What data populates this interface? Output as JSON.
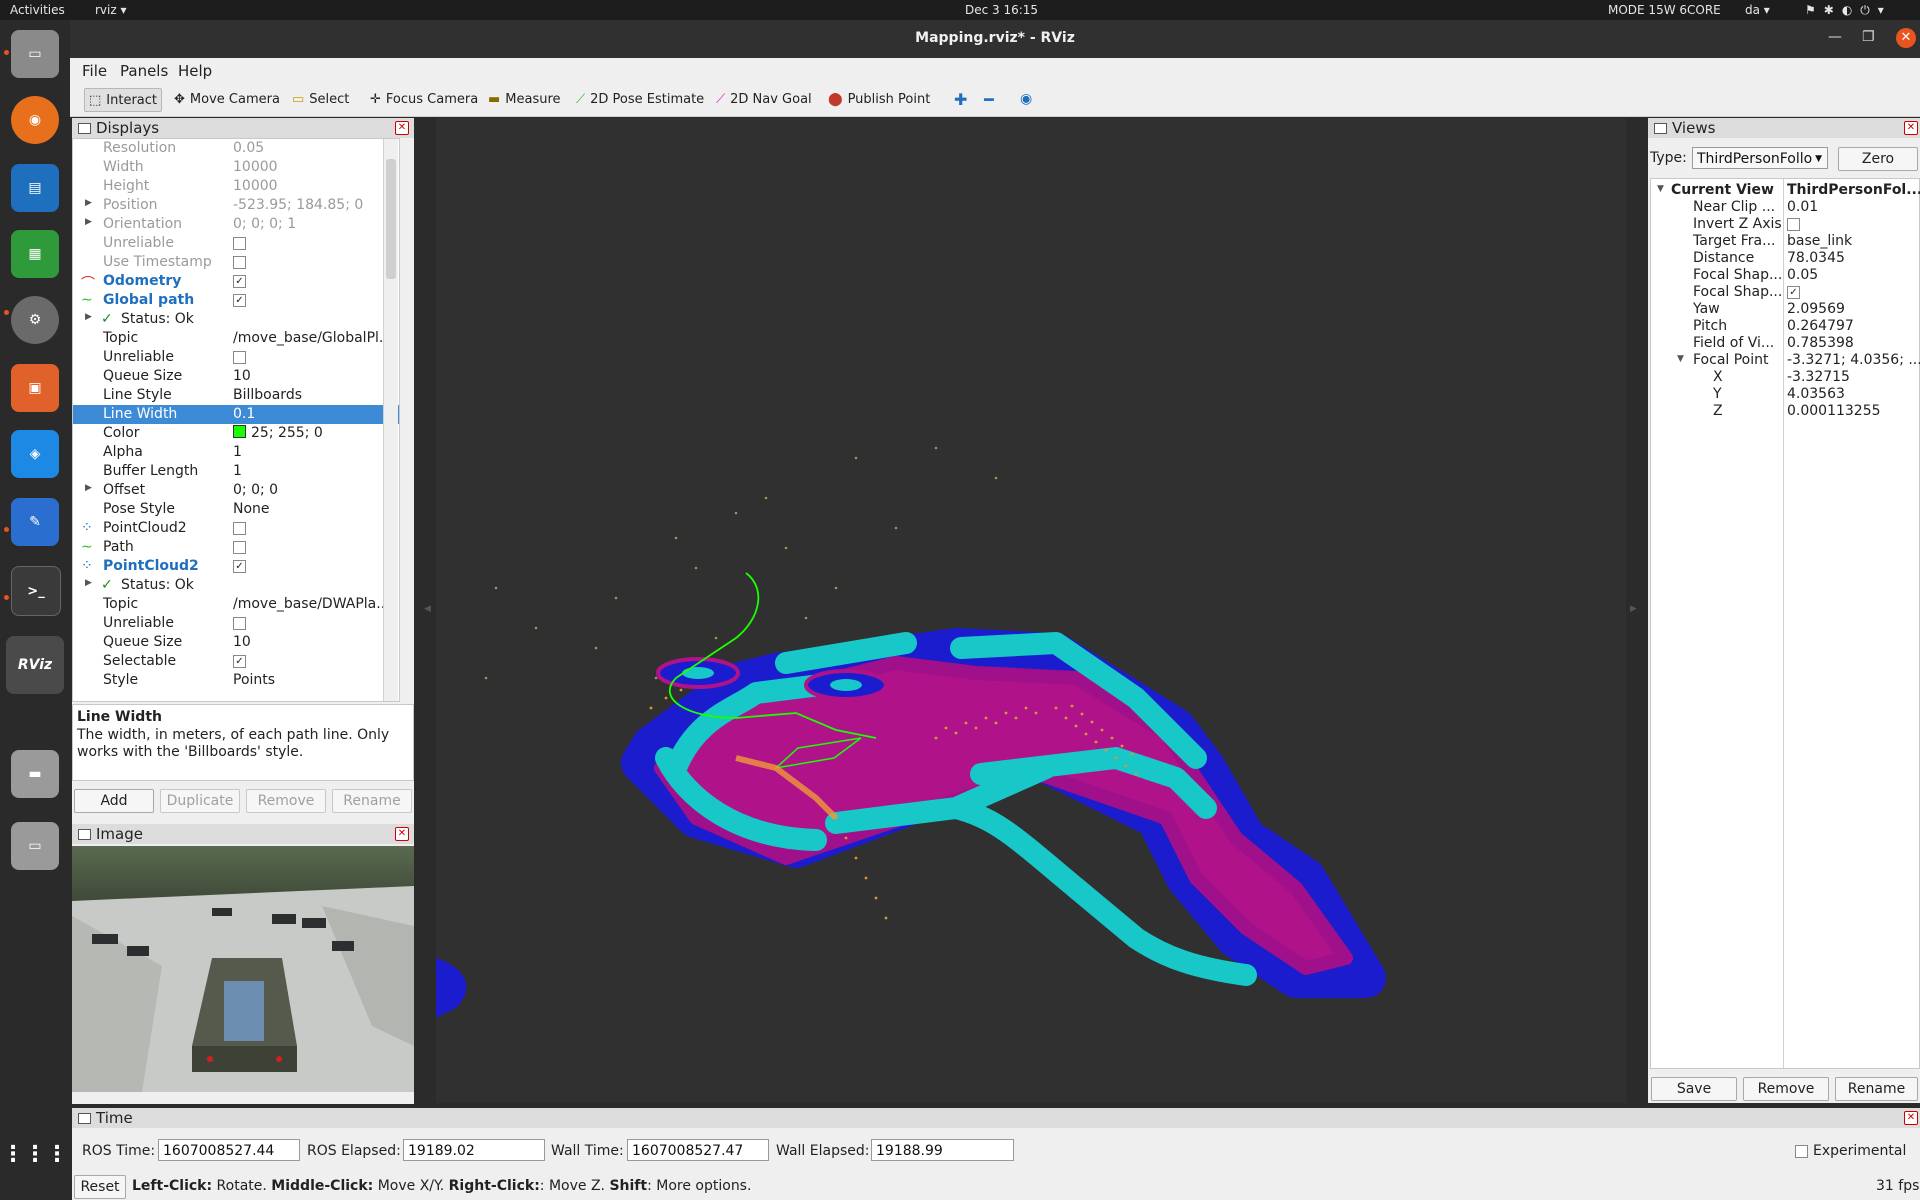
{
  "system_bar": {
    "activities": "Activities",
    "app": "rviz",
    "clock": "Dec 3  16:15",
    "mode": "MODE 15W 6CORE",
    "user": "da"
  },
  "window": {
    "title": "Mapping.rviz* - RViz"
  },
  "menu": {
    "file": "File",
    "panels": "Panels",
    "help": "Help"
  },
  "toolbar": {
    "interact": "Interact",
    "move_camera": "Move Camera",
    "select": "Select",
    "focus_camera": "Focus Camera",
    "measure": "Measure",
    "pose_estimate": "2D Pose Estimate",
    "nav_goal": "2D Nav Goal",
    "publish_point": "Publish Point"
  },
  "displays": {
    "title": "Displays",
    "rows": [
      {
        "key": "Resolution",
        "value": "0.05"
      },
      {
        "key": "Width",
        "value": "10000"
      },
      {
        "key": "Height",
        "value": "10000"
      },
      {
        "key": "Position",
        "value": "-523.95; 184.85; 0"
      },
      {
        "key": "Orientation",
        "value": "0; 0; 0; 1"
      },
      {
        "key": "Unreliable",
        "value": ""
      },
      {
        "key": "Use Timestamp",
        "value": ""
      },
      {
        "key": "Odometry",
        "value": ""
      },
      {
        "key": "Global path",
        "value": ""
      },
      {
        "key": "Status: Ok",
        "value": ""
      },
      {
        "key": "Topic",
        "value": "/move_base/GlobalPl..."
      },
      {
        "key": "Unreliable",
        "value": ""
      },
      {
        "key": "Queue Size",
        "value": "10"
      },
      {
        "key": "Line Style",
        "value": "Billboards"
      },
      {
        "key": "Line Width",
        "value": "0.1"
      },
      {
        "key": "Color",
        "value": "25; 255; 0"
      },
      {
        "key": "Alpha",
        "value": "1"
      },
      {
        "key": "Buffer Length",
        "value": "1"
      },
      {
        "key": "Offset",
        "value": "0; 0; 0"
      },
      {
        "key": "Pose Style",
        "value": "None"
      },
      {
        "key": "PointCloud2",
        "value": ""
      },
      {
        "key": "Path",
        "value": ""
      },
      {
        "key": "PointCloud2",
        "value": ""
      },
      {
        "key": "Status: Ok",
        "value": ""
      },
      {
        "key": "Topic",
        "value": "/move_base/DWAPla..."
      },
      {
        "key": "Unreliable",
        "value": ""
      },
      {
        "key": "Queue Size",
        "value": "10"
      },
      {
        "key": "Selectable",
        "value": ""
      },
      {
        "key": "Style",
        "value": "Points"
      }
    ],
    "help_title": "Line Width",
    "help_text": "The width, in meters, of each path line. Only works with the 'Billboards' style.",
    "buttons": {
      "add": "Add",
      "duplicate": "Duplicate",
      "remove": "Remove",
      "rename": "Rename"
    }
  },
  "image_panel": {
    "title": "Image"
  },
  "views": {
    "title": "Views",
    "type_label": "Type:",
    "type_value": "ThirdPersonFollo",
    "zero": "Zero",
    "rows": [
      {
        "key": "Current View",
        "value": "ThirdPersonFol..."
      },
      {
        "key": "Near Clip ...",
        "value": "0.01"
      },
      {
        "key": "Invert Z Axis",
        "value": ""
      },
      {
        "key": "Target Fra...",
        "value": "base_link"
      },
      {
        "key": "Distance",
        "value": "78.0345"
      },
      {
        "key": "Focal Shap...",
        "value": "0.05"
      },
      {
        "key": "Focal Shap...",
        "value": ""
      },
      {
        "key": "Yaw",
        "value": "2.09569"
      },
      {
        "key": "Pitch",
        "value": "0.264797"
      },
      {
        "key": "Field of Vi...",
        "value": "0.785398"
      },
      {
        "key": "Focal Point",
        "value": "-3.3271; 4.0356; ..."
      },
      {
        "key": "X",
        "value": "-3.32715"
      },
      {
        "key": "Y",
        "value": "4.03563"
      },
      {
        "key": "Z",
        "value": "0.000113255"
      }
    ],
    "buttons": {
      "save": "Save",
      "remove": "Remove",
      "rename": "Rename"
    }
  },
  "time": {
    "title": "Time",
    "ros_time_label": "ROS Time:",
    "ros_time": "1607008527.44",
    "ros_elapsed_label": "ROS Elapsed:",
    "ros_elapsed": "19189.02",
    "wall_time_label": "Wall Time:",
    "wall_time": "1607008527.47",
    "wall_elapsed_label": "Wall Elapsed:",
    "wall_elapsed": "19188.99",
    "experimental": "Experimental"
  },
  "status": {
    "reset": "Reset",
    "lc": "Left-Click:",
    "lc_t": " Rotate.",
    "mc": "Middle-Click:",
    "mc_t": " Move X/Y.",
    "rc": "Right-Click:",
    "rc_t": ": Move Z.",
    "sh": "Shift",
    "sh_t": ": More options.",
    "fps": "31 fps"
  },
  "colors": {
    "accent": "#3d8ad6",
    "path": "#19ff00",
    "map_fill": "#1a1acc",
    "free": "#15c7c7"
  }
}
